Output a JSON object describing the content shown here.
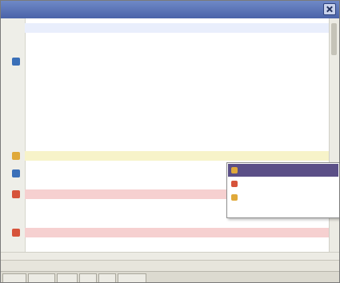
{
  "window": {
    "title": ""
  },
  "editor": {
    "lines": []
  },
  "popup": {
    "items": [
      {
        "label": ""
      },
      {
        "label": ""
      },
      {
        "label": ""
      }
    ]
  },
  "statusbar": {
    "segments": [
      {
        "text": ""
      },
      {
        "text": ""
      },
      {
        "text": ""
      }
    ]
  },
  "tabs": [
    {
      "label": ""
    },
    {
      "label": ""
    },
    {
      "label": ""
    },
    {
      "label": ""
    },
    {
      "label": ""
    },
    {
      "label": ""
    }
  ],
  "colors": {
    "titlebar": "#4a63a8",
    "error_line": "#f6d0d0",
    "warning_line": "#f7f3c9",
    "popup_selection": "#5b4f87",
    "comment_text": "#3b8a3b"
  },
  "icons": {
    "close": "close-icon",
    "error": "error-marker-icon",
    "warning": "warning-marker-icon",
    "breakpoint": "breakpoint-marker-icon",
    "quickfix": "quickfix-icon"
  }
}
